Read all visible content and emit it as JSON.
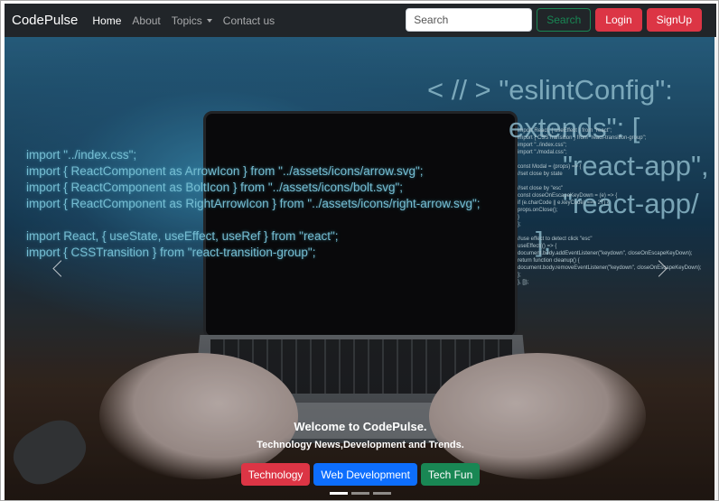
{
  "navbar": {
    "brand": "CodePulse",
    "links": [
      "Home",
      "About",
      "Topics",
      "Contact us"
    ],
    "search_placeholder": "Search",
    "search_button": "Search",
    "login": "Login",
    "signup": "SignUp"
  },
  "hero": {
    "code_left": [
      "import \"../index.css\";",
      "import { ReactComponent as ArrowIcon } from \"../assets/icons/arrow.svg\";",
      "import { ReactComponent as BoltIcon } from \"../assets/icons/bolt.svg\";",
      "import { ReactComponent as RightArrowIcon } from \"../assets/icons/right-arrow.svg\";",
      "",
      "import React, { useState, useEffect, useRef } from \"react\";",
      "import { CSSTransition } from \"react-transition-group\";"
    ],
    "code_right": [
      "import React, { useEffect } from \"react\";",
      "import { CSSTransition } from \"react-transition-group\";",
      "import \"../index.css\";",
      "import \"./modal.css\";",
      "",
      "const Modal = (props) => {",
      "  //set close by state",
      "",
      "  //set close by \"esc\"",
      "  const closeOnEscapeKeyDown = (e) => {",
      "    if (e.charCode || e.keyCode) === 27) {",
      "      props.onClose();",
      "    }",
      "  };",
      "",
      "  //use effect to detect click \"esc\"",
      "  useEffect(() => {",
      "    document.body.addEventListener(\"keydown\", closeOnEscapeKeyDown);",
      "    return function cleanup() {",
      "      document.body.removeEventListener(\"keydown\", closeOnEscapeKeyDown);",
      "    };",
      "  }, []);"
    ],
    "code_big": [
      "< // > \"eslintConfig\":",
      "extends\": [",
      "\"react-app\",",
      "\"react-app/",
      "],"
    ],
    "title": "Welcome to CodePulse.",
    "subtitle": "Technology News,Development and Trends.",
    "buttons": [
      "Technology",
      "Web Development",
      "Tech Fun"
    ],
    "indicators": 3
  }
}
